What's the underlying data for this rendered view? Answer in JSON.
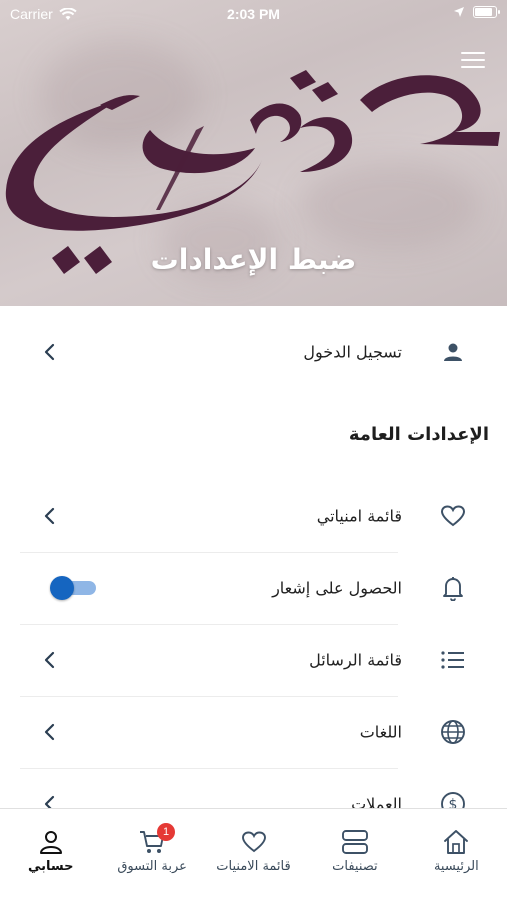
{
  "status_bar": {
    "carrier": "Carrier",
    "time": "2:03 PM",
    "battery_level": 0.9
  },
  "header": {
    "title": "ضبط الإعدادات",
    "menu_icon": "hamburger-menu-icon",
    "logo_color": "#4b1f3a"
  },
  "login": {
    "label": "تسجيل الدخول",
    "icon": "user-icon"
  },
  "general": {
    "title": "الإعدادات العامة",
    "items": [
      {
        "label": "قائمة امنياتي",
        "icon": "heart-icon",
        "type": "link"
      },
      {
        "label": "الحصول على إشعار",
        "icon": "bell-icon",
        "type": "toggle",
        "value": true
      },
      {
        "label": "قائمة الرسائل",
        "icon": "list-icon",
        "type": "link"
      },
      {
        "label": "اللغات",
        "icon": "globe-icon",
        "type": "link"
      },
      {
        "label": "العملات",
        "icon": "dollar-icon",
        "type": "link"
      }
    ]
  },
  "tabbar": {
    "tabs": [
      {
        "label": "الرئيسية",
        "icon": "home-icon",
        "active": false
      },
      {
        "label": "تصنيفات",
        "icon": "categories-icon",
        "active": false
      },
      {
        "label": "قائمة الامنيات",
        "icon": "heart-icon",
        "active": false
      },
      {
        "label": "عربة التسوق",
        "icon": "cart-icon",
        "active": false,
        "badge": "1"
      },
      {
        "label": "حسابي",
        "icon": "account-icon",
        "active": true
      }
    ]
  },
  "colors": {
    "accent": "#1565c0",
    "toggle_track": "#8fb6e6",
    "badge": "#e53935",
    "icon": "#3d5166"
  }
}
